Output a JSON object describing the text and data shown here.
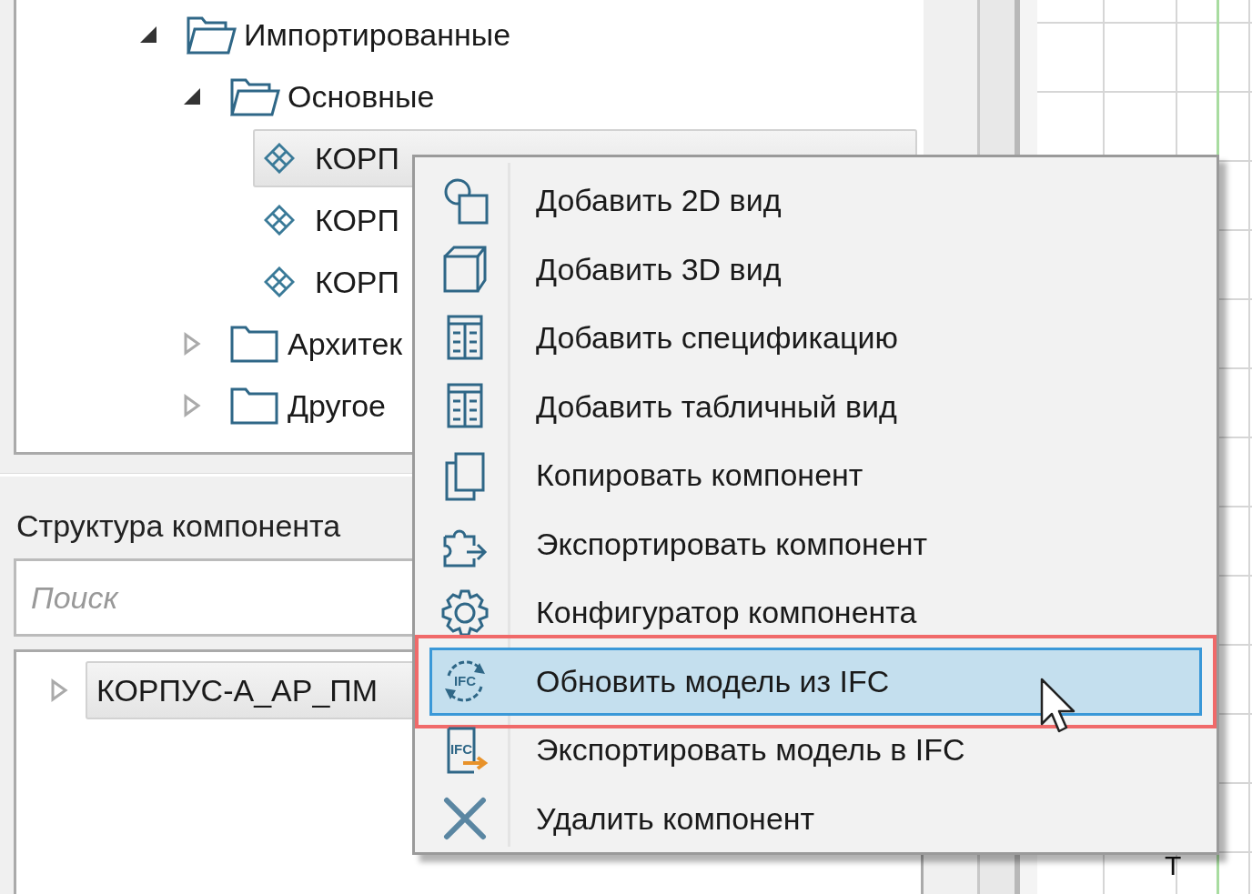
{
  "project_tree": {
    "items": [
      {
        "label": "Импортированные",
        "kind": "folder",
        "expanded": true,
        "children": [
          {
            "label": "Основные",
            "kind": "folder",
            "expanded": true,
            "children": [
              {
                "label": "КОРП",
                "kind": "component",
                "selected": true
              },
              {
                "label": "КОРП",
                "kind": "component",
                "selected": false
              },
              {
                "label": "КОРП",
                "kind": "component",
                "selected": false
              }
            ]
          },
          {
            "label": "Архитек",
            "kind": "folder",
            "expanded": false
          },
          {
            "label": "Другое",
            "kind": "folder",
            "expanded": false
          }
        ]
      }
    ]
  },
  "structure_panel": {
    "title": "Структура компонента",
    "search": {
      "placeholder": "Поиск"
    },
    "tree": {
      "items": [
        {
          "label": "КОРПУС-А_АР_ПМ",
          "expanded": false,
          "selected": true
        }
      ]
    }
  },
  "context_menu": {
    "items": [
      {
        "label": "Добавить 2D вид",
        "selected": false,
        "outlined": false
      },
      {
        "label": "Добавить 3D вид",
        "selected": false,
        "outlined": false
      },
      {
        "label": "Добавить спецификацию",
        "selected": false,
        "outlined": false
      },
      {
        "label": "Добавить табличный вид",
        "selected": false,
        "outlined": false
      },
      {
        "label": "Копировать компонент",
        "selected": false,
        "outlined": false
      },
      {
        "label": "Экспортировать компонент",
        "selected": false,
        "outlined": false
      },
      {
        "label": "Конфигуратор компонента",
        "selected": false,
        "outlined": false
      },
      {
        "label": "Обновить модель из IFC",
        "icon_label": "IFC",
        "selected": true,
        "outlined": true
      },
      {
        "label": "Экспортировать модель в IFC",
        "icon_label": "IFC",
        "selected": false,
        "outlined": false
      },
      {
        "label": "Удалить компонент",
        "selected": false,
        "outlined": false
      }
    ]
  },
  "canvas": {
    "label": "Т"
  }
}
